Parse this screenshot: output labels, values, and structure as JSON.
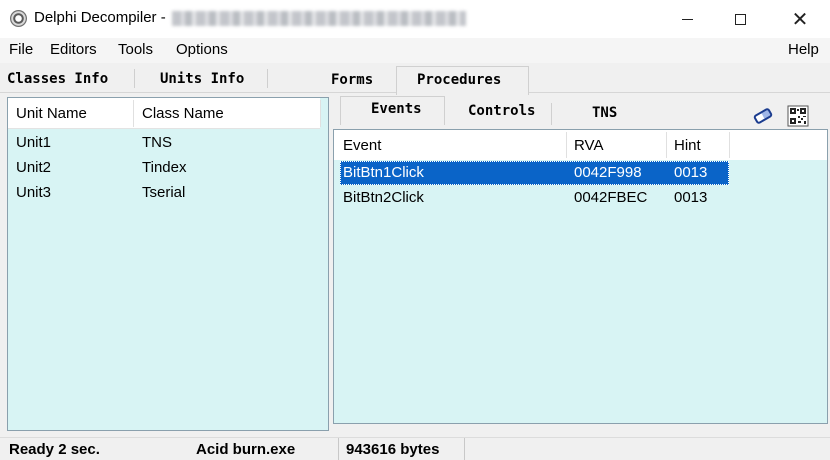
{
  "window": {
    "title": "Delphi Decompiler -",
    "minimize_label": "Minimize",
    "maximize_label": "Maximize",
    "close_label": "Close"
  },
  "menu": {
    "file": "File",
    "editors": "Editors",
    "tools": "Tools",
    "options": "Options",
    "help": "Help"
  },
  "main_tabs": {
    "classes_info": "Classes Info",
    "units_info": "Units Info",
    "forms": "Forms",
    "procedures": "Procedures",
    "active": "Procedures"
  },
  "units_list": {
    "columns": [
      "Unit Name",
      "Class Name"
    ],
    "rows": [
      [
        "Unit1",
        "TNS"
      ],
      [
        "Unit2",
        "Tindex"
      ],
      [
        "Unit3",
        "Tserial"
      ]
    ]
  },
  "sub_tabs": {
    "events": "Events",
    "controls": "Controls",
    "active": "Events",
    "class_name": "TNS"
  },
  "toolbar_icons": [
    "eraser-icon",
    "qr-code-icon"
  ],
  "events_list": {
    "columns": [
      "Event",
      "RVA",
      "Hint"
    ],
    "rows": [
      [
        "BitBtn1Click",
        "0042F998",
        "0013"
      ],
      [
        "BitBtn2Click",
        "0042FBEC",
        "0013"
      ]
    ],
    "selected_index": 0
  },
  "status": {
    "ready": "Ready 2 sec.",
    "file": "Acid burn.exe",
    "size": "943616 bytes"
  },
  "colors": {
    "list_background": "#d8f4f4",
    "selection": "#0a64c8",
    "window_background": "#f0f0f0"
  }
}
